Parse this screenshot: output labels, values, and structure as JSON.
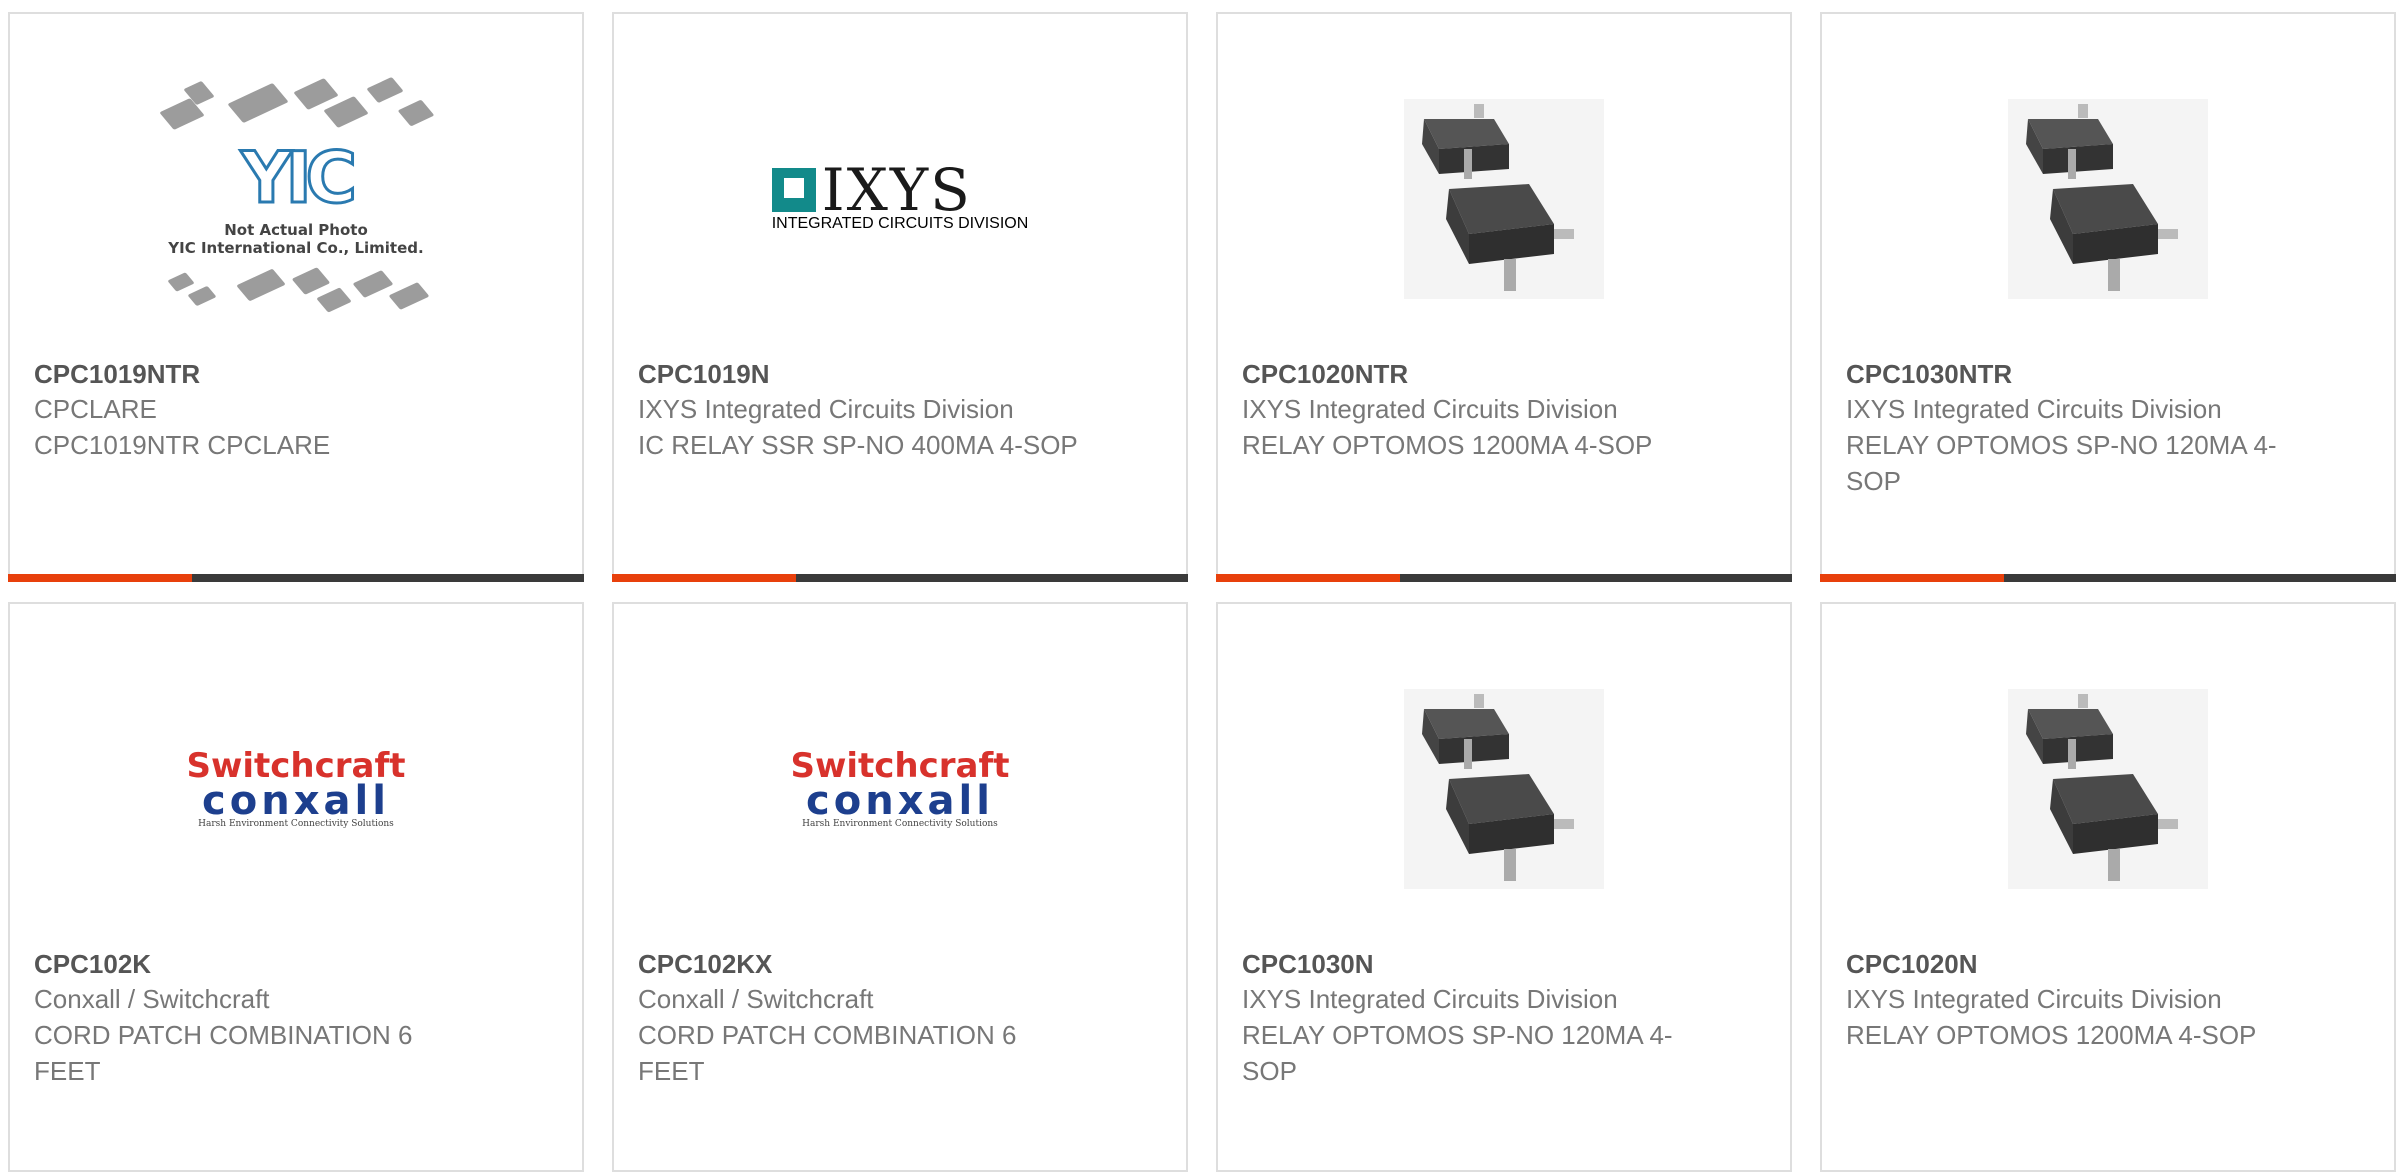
{
  "products": [
    {
      "part": "CPC1019NTR",
      "manufacturer": "CPCLARE",
      "description": "CPC1019NTR CPCLARE",
      "image": "placeholder-logo"
    },
    {
      "part": "CPC1019N",
      "manufacturer": "IXYS Integrated Circuits Division",
      "description": "IC RELAY SSR SP-NO 400MA 4-SOP",
      "image": "ixys-logo"
    },
    {
      "part": "CPC1020NTR",
      "manufacturer": "IXYS Integrated Circuits Division",
      "description": "RELAY OPTOMOS 1200MA 4-SOP",
      "image": "relay-photo"
    },
    {
      "part": "CPC1030NTR",
      "manufacturer": "IXYS Integrated Circuits Division",
      "description": "RELAY OPTOMOS SP-NO 120MA 4-SOP",
      "image": "relay-photo"
    },
    {
      "part": "CPC102K",
      "manufacturer": "Conxall / Switchcraft",
      "description": "CORD PATCH COMBINATION 6 FEET",
      "image": "switchcraft-logo"
    },
    {
      "part": "CPC102KX",
      "manufacturer": "Conxall / Switchcraft",
      "description": "CORD PATCH COMBINATION 6 FEET",
      "image": "switchcraft-logo"
    },
    {
      "part": "CPC1030N",
      "manufacturer": "IXYS Integrated Circuits Division",
      "description": "RELAY OPTOMOS SP-NO 120MA 4-SOP",
      "image": "relay-photo"
    },
    {
      "part": "CPC1020N",
      "manufacturer": "IXYS Integrated Circuits Division",
      "description": "RELAY OPTOMOS 1200MA 4-SOP",
      "image": "relay-photo"
    }
  ],
  "placeholder": {
    "brand": "YIC",
    "line1": "Not Actual Photo",
    "line2": "YIC International Co., Limited."
  },
  "ixys_logo": {
    "word": "IXYS",
    "sub": "INTEGRATED CIRCUITS DIVISION"
  },
  "switchcraft_logo": {
    "top": "Switchcraft",
    "bottom": "conxall",
    "tagline": "Harsh Environment Connectivity Solutions"
  },
  "colors": {
    "accent": "#e8400c",
    "bar": "#3a3a3a",
    "border": "#dedede",
    "text_bold": "#555555",
    "text": "#777777"
  }
}
